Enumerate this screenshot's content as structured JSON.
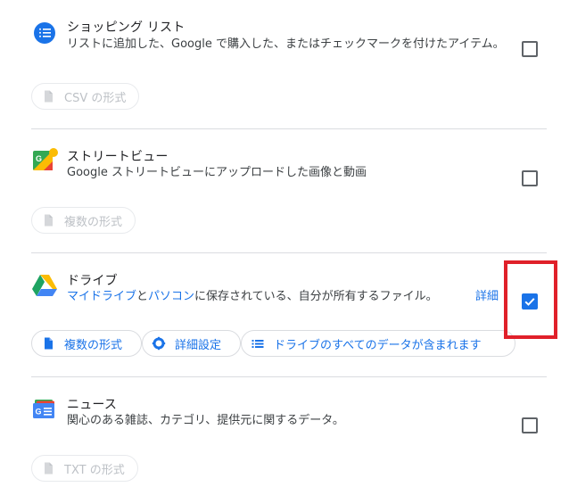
{
  "sections": {
    "shopping": {
      "title": "ショッピング リスト",
      "desc": "リストに追加した、Google で購入した、またはチェックマークを付けたアイテム。",
      "chip": "CSV の形式",
      "checked": false
    },
    "streetview": {
      "title": "ストリートビュー",
      "desc": "Google ストリートビューにアップロードした画像と動画",
      "chip": "複数の形式",
      "checked": false
    },
    "drive": {
      "title": "ドライブ",
      "desc_link1": "マイドライブ",
      "desc_and": "と",
      "desc_link2": "パソコン",
      "desc_rest": "に保存されている、自分が所有するファイル。",
      "details_link": "詳細",
      "chip_format": "複数の形式",
      "chip_settings": "詳細設定",
      "chip_all_data": "ドライブのすべてのデータが含まれます",
      "checked": true
    },
    "news": {
      "title": "ニュース",
      "desc": "関心のある雑誌、カテゴリ、提供元に関するデータ。",
      "chip": "TXT の形式",
      "checked": false
    }
  },
  "icons": {
    "shopping": "shopping-list-icon",
    "streetview": "street-view-icon",
    "drive": "google-drive-icon",
    "news": "google-news-icon",
    "file": "file-icon",
    "gear": "gear-icon",
    "list": "list-icon",
    "check": "checkmark-icon"
  },
  "colors": {
    "accent": "#1a73e8",
    "highlight": "#e0202a",
    "divider": "#dadce0",
    "disabled": "#bdc1c6"
  }
}
